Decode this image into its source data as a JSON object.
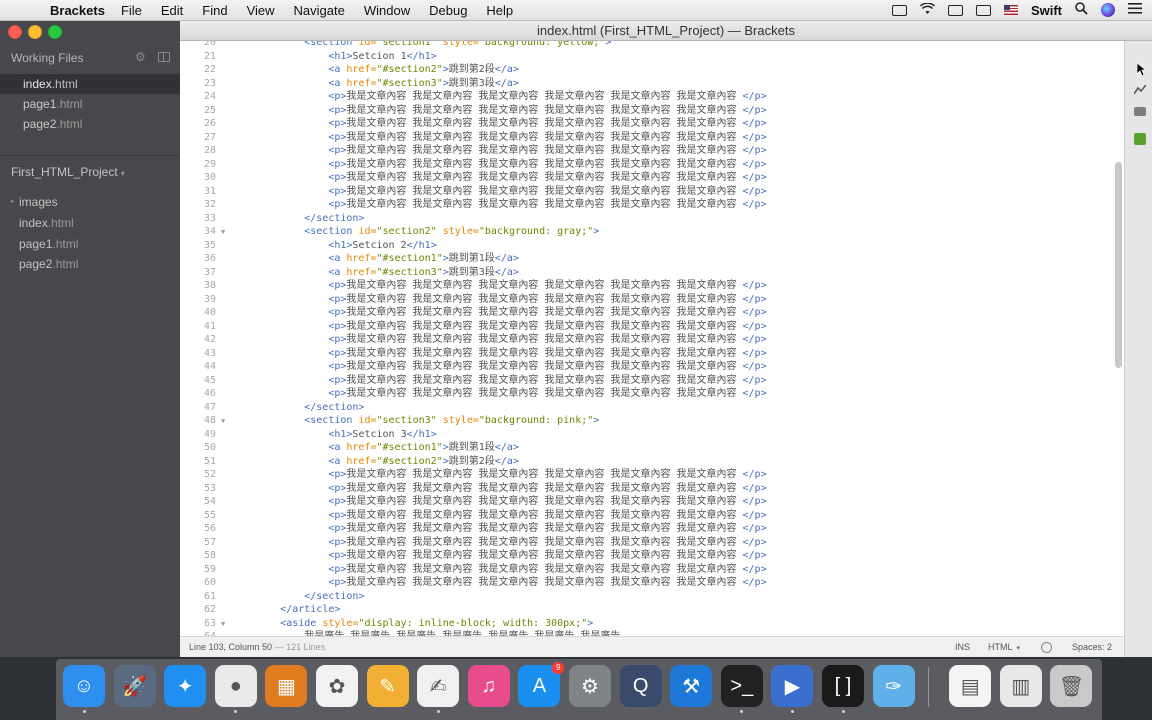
{
  "menubar": {
    "apple_glyph": "",
    "app_name": "Brackets",
    "menus": [
      "File",
      "Edit",
      "Find",
      "View",
      "Navigate",
      "Window",
      "Debug",
      "Help"
    ],
    "right": {
      "input_source": "Swift"
    }
  },
  "window": {
    "title": "index.html (First_HTML_Project) — Brackets"
  },
  "sidebar": {
    "working_files_label": "Working Files",
    "working_files": [
      {
        "name": "index",
        "ext": ".html",
        "active": true
      },
      {
        "name": "page1",
        "ext": ".html",
        "active": false
      },
      {
        "name": "page2",
        "ext": ".html",
        "active": false
      }
    ],
    "project_name": "First_HTML_Project",
    "tree": [
      {
        "name": "images",
        "ext": "",
        "folder": true
      },
      {
        "name": "index",
        "ext": ".html",
        "folder": false
      },
      {
        "name": "page1",
        "ext": ".html",
        "folder": false
      },
      {
        "name": "page2",
        "ext": ".html",
        "folder": false
      }
    ]
  },
  "editor": {
    "lines": [
      {
        "n": 20,
        "fold": false,
        "tokens": [
          [
            "",
            "            "
          ],
          [
            "tag",
            "<section "
          ],
          [
            "attr",
            "id="
          ],
          [
            "str",
            "\"section1\""
          ],
          [
            "txt",
            " "
          ],
          [
            "attr",
            "style="
          ],
          [
            "str",
            "\"background: yellow;\""
          ],
          [
            "tag",
            ">"
          ]
        ]
      },
      {
        "n": 21,
        "fold": false,
        "tokens": [
          [
            "",
            "                "
          ],
          [
            "tag",
            "<h1>"
          ],
          [
            "txt",
            "Setcion 1"
          ],
          [
            "tag",
            "</h1>"
          ]
        ]
      },
      {
        "n": 22,
        "fold": false,
        "tokens": [
          [
            "",
            "                "
          ],
          [
            "tag",
            "<a "
          ],
          [
            "attr",
            "href="
          ],
          [
            "str",
            "\"#section2\""
          ],
          [
            "tag",
            ">"
          ],
          [
            "txt",
            "跳到第2段"
          ],
          [
            "tag",
            "</a>"
          ]
        ]
      },
      {
        "n": 23,
        "fold": false,
        "tokens": [
          [
            "",
            "                "
          ],
          [
            "tag",
            "<a "
          ],
          [
            "attr",
            "href="
          ],
          [
            "str",
            "\"#section3\""
          ],
          [
            "tag",
            ">"
          ],
          [
            "txt",
            "跳到第3段"
          ],
          [
            "tag",
            "</a>"
          ]
        ]
      },
      {
        "n": 24,
        "fold": false,
        "p": true
      },
      {
        "n": 25,
        "fold": false,
        "p": true
      },
      {
        "n": 26,
        "fold": false,
        "p": true
      },
      {
        "n": 27,
        "fold": false,
        "p": true
      },
      {
        "n": 28,
        "fold": false,
        "p": true
      },
      {
        "n": 29,
        "fold": false,
        "p": true
      },
      {
        "n": 30,
        "fold": false,
        "p": true
      },
      {
        "n": 31,
        "fold": false,
        "p": true
      },
      {
        "n": 32,
        "fold": false,
        "p": true
      },
      {
        "n": 33,
        "fold": false,
        "tokens": [
          [
            "",
            "            "
          ],
          [
            "tag",
            "</section>"
          ]
        ]
      },
      {
        "n": 34,
        "fold": true,
        "tokens": [
          [
            "",
            "            "
          ],
          [
            "tag",
            "<section "
          ],
          [
            "attr",
            "id="
          ],
          [
            "str",
            "\"section2\""
          ],
          [
            "txt",
            " "
          ],
          [
            "attr",
            "style="
          ],
          [
            "str",
            "\"background: gray;\""
          ],
          [
            "tag",
            ">"
          ]
        ]
      },
      {
        "n": 35,
        "fold": false,
        "tokens": [
          [
            "",
            "                "
          ],
          [
            "tag",
            "<h1>"
          ],
          [
            "txt",
            "Setcion 2"
          ],
          [
            "tag",
            "</h1>"
          ]
        ]
      },
      {
        "n": 36,
        "fold": false,
        "tokens": [
          [
            "",
            "                "
          ],
          [
            "tag",
            "<a "
          ],
          [
            "attr",
            "href="
          ],
          [
            "str",
            "\"#section1\""
          ],
          [
            "tag",
            ">"
          ],
          [
            "txt",
            "跳到第1段"
          ],
          [
            "tag",
            "</a>"
          ]
        ]
      },
      {
        "n": 37,
        "fold": false,
        "tokens": [
          [
            "",
            "                "
          ],
          [
            "tag",
            "<a "
          ],
          [
            "attr",
            "href="
          ],
          [
            "str",
            "\"#section3\""
          ],
          [
            "tag",
            ">"
          ],
          [
            "txt",
            "跳到第3段"
          ],
          [
            "tag",
            "</a>"
          ]
        ]
      },
      {
        "n": 38,
        "fold": false,
        "p": true
      },
      {
        "n": 39,
        "fold": false,
        "p": true
      },
      {
        "n": 40,
        "fold": false,
        "p": true
      },
      {
        "n": 41,
        "fold": false,
        "p": true
      },
      {
        "n": 42,
        "fold": false,
        "p": true
      },
      {
        "n": 43,
        "fold": false,
        "p": true
      },
      {
        "n": 44,
        "fold": false,
        "p": true
      },
      {
        "n": 45,
        "fold": false,
        "p": true
      },
      {
        "n": 46,
        "fold": false,
        "p": true
      },
      {
        "n": 47,
        "fold": false,
        "tokens": [
          [
            "",
            "            "
          ],
          [
            "tag",
            "</section>"
          ]
        ]
      },
      {
        "n": 48,
        "fold": true,
        "tokens": [
          [
            "",
            "            "
          ],
          [
            "tag",
            "<section "
          ],
          [
            "attr",
            "id="
          ],
          [
            "str",
            "\"section3\""
          ],
          [
            "txt",
            " "
          ],
          [
            "attr",
            "style="
          ],
          [
            "str",
            "\"background: pink;\""
          ],
          [
            "tag",
            ">"
          ]
        ]
      },
      {
        "n": 49,
        "fold": false,
        "tokens": [
          [
            "",
            "                "
          ],
          [
            "tag",
            "<h1>"
          ],
          [
            "txt",
            "Setcion 3"
          ],
          [
            "tag",
            "</h1>"
          ]
        ]
      },
      {
        "n": 50,
        "fold": false,
        "tokens": [
          [
            "",
            "                "
          ],
          [
            "tag",
            "<a "
          ],
          [
            "attr",
            "href="
          ],
          [
            "str",
            "\"#section1\""
          ],
          [
            "tag",
            ">"
          ],
          [
            "txt",
            "跳到第1段"
          ],
          [
            "tag",
            "</a>"
          ]
        ]
      },
      {
        "n": 51,
        "fold": false,
        "tokens": [
          [
            "",
            "                "
          ],
          [
            "tag",
            "<a "
          ],
          [
            "attr",
            "href="
          ],
          [
            "str",
            "\"#section2\""
          ],
          [
            "tag",
            ">"
          ],
          [
            "txt",
            "跳到第2段"
          ],
          [
            "tag",
            "</a>"
          ]
        ]
      },
      {
        "n": 52,
        "fold": false,
        "p": true
      },
      {
        "n": 53,
        "fold": false,
        "p": true
      },
      {
        "n": 54,
        "fold": false,
        "p": true
      },
      {
        "n": 55,
        "fold": false,
        "p": true
      },
      {
        "n": 56,
        "fold": false,
        "p": true
      },
      {
        "n": 57,
        "fold": false,
        "p": true
      },
      {
        "n": 58,
        "fold": false,
        "p": true
      },
      {
        "n": 59,
        "fold": false,
        "p": true
      },
      {
        "n": 60,
        "fold": false,
        "p": true
      },
      {
        "n": 61,
        "fold": false,
        "tokens": [
          [
            "",
            "            "
          ],
          [
            "tag",
            "</section>"
          ]
        ]
      },
      {
        "n": 62,
        "fold": false,
        "tokens": [
          [
            "",
            "        "
          ],
          [
            "tag",
            "</article>"
          ]
        ]
      },
      {
        "n": 63,
        "fold": true,
        "tokens": [
          [
            "",
            "        "
          ],
          [
            "tag",
            "<aside "
          ],
          [
            "attr",
            "style="
          ],
          [
            "str",
            "\"display: inline-block; width: 300px;\""
          ],
          [
            "tag",
            ">"
          ]
        ]
      },
      {
        "n": 64,
        "fold": false,
        "tokens": [
          [
            "",
            "            "
          ],
          [
            "txt",
            "我是廣告 我是廣告 我是廣告 我是廣告 我是廣告 我是廣告 我是廣告"
          ]
        ]
      }
    ],
    "paragraph_text": "我是文章內容 我是文章內容 我是文章內容 我是文章內容 我是文章內容 我是文章內容 "
  },
  "statusbar": {
    "cursor_position": "Line 103, Column 50",
    "line_count": "— 121 Lines",
    "insert_mode": "INS",
    "language": "HTML",
    "indent": "Spaces: 2"
  },
  "dock": {
    "apps": [
      {
        "name": "finder-icon",
        "glyph": "☺",
        "bg": "#2f8ff0",
        "running": true
      },
      {
        "name": "launchpad-icon",
        "glyph": "🚀",
        "bg": "#5a6a80",
        "running": false
      },
      {
        "name": "safari-icon",
        "glyph": "✦",
        "bg": "#1f8ff2",
        "running": false
      },
      {
        "name": "chrome-icon",
        "glyph": "●",
        "bg": "#e9e9e9",
        "running": true
      },
      {
        "name": "calculator-icon",
        "glyph": "▦",
        "bg": "#e07b20",
        "running": false
      },
      {
        "name": "photos-icon",
        "glyph": "✿",
        "bg": "#f2f2f2",
        "running": false
      },
      {
        "name": "pages-icon",
        "glyph": "✎",
        "bg": "#f1b034",
        "running": false
      },
      {
        "name": "textedit-icon",
        "glyph": "✍",
        "bg": "#f0f0f0",
        "running": true
      },
      {
        "name": "itunes-icon",
        "glyph": "♫",
        "bg": "#e94c8c",
        "running": false
      },
      {
        "name": "app-store-icon",
        "glyph": "A",
        "bg": "#1b8ff0",
        "running": false,
        "badge": "9"
      },
      {
        "name": "system-preferences-icon",
        "glyph": "⚙",
        "bg": "#7f8388",
        "running": false
      },
      {
        "name": "quicktime-icon",
        "glyph": "Q",
        "bg": "#3a4a6a",
        "running": false
      },
      {
        "name": "xcode-icon",
        "glyph": "⚒",
        "bg": "#1e78d8",
        "running": false
      },
      {
        "name": "terminal-icon",
        "glyph": ">_",
        "bg": "#222222",
        "running": true
      },
      {
        "name": "screenflow-icon",
        "glyph": "▶",
        "bg": "#3a6fd0",
        "running": true
      },
      {
        "name": "brackets-icon",
        "glyph": "[ ]",
        "bg": "#1a1a1a",
        "running": true
      },
      {
        "name": "color-picker-icon",
        "glyph": "✑",
        "bg": "#5fb0e8",
        "running": false
      },
      {
        "name": "pdf-document-icon",
        "glyph": "▤",
        "bg": "#f4f4f4",
        "running": false
      },
      {
        "name": "screenshot-document-icon",
        "glyph": "▥",
        "bg": "#e8e8e8",
        "running": false
      },
      {
        "name": "trash-icon",
        "glyph": "🗑",
        "bg": "#c9c9c9",
        "running": false
      }
    ]
  }
}
